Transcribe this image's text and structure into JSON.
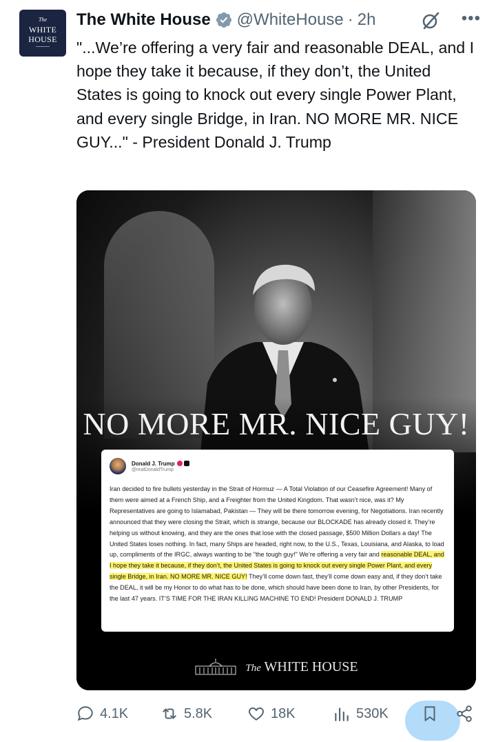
{
  "account": {
    "avatar_line1": "The",
    "avatar_line2": "WHITE",
    "avatar_line3": "HOUSE",
    "name": "The White House",
    "handle": "@WhiteHouse",
    "separator": "·",
    "time": "2h",
    "verified_icon": "verified-badge-icon",
    "more_label": "•••"
  },
  "tweet": {
    "text": "\"...We’re offering a very fair and reasonable DEAL, and I hope they take it because, if they don’t, the United States is going to knock out every single Power Plant, and every single Bridge, in Iran. NO MORE MR. NICE GUY...\" - President Donald J. Trump"
  },
  "media": {
    "headline": "NO MORE MR. NICE GUY!",
    "card": {
      "name": "Donald J. Trump",
      "handle": "@realDonaldTrump",
      "body_before": "Iran decided to fire bullets yesterday in the Strait of Hormuz — A Total Violation of our Ceasefire Agreement! Many of them were aimed at a French Ship, and a Freighter from the United Kingdom. That wasn’t nice, was it? My Representatives are going to Islamabad, Pakistan — They will be there tomorrow evening, for Negotiations. Iran recently announced that they were closing the Strait, which is strange, because our BLOCKADE has already closed it. They’re helping us without knowing, and they are the ones that lose with the closed passage, $500 Million Dollars a day! The United States loses nothing. In fact, many Ships are headed, right now, to the U.S., Texas, Louisiana, and Alaska, to load up, compliments of the IRGC, always wanting to be \"the tough guy!\" We’re offering a very fair and ",
      "body_highlight": "reasonable DEAL, and I hope they take it because, if they don’t, the United States is going to knock out every single Power Plant, and every single Bridge, in Iran. NO MORE MR. NICE GUY!",
      "body_after": " They’ll come down fast, they’ll come down easy and, if they don’t take the DEAL, it will be my Honor to do what has to be done, which should have been done to Iran, by other Presidents, for the last 47 years. IT’S TIME FOR THE IRAN KILLING MACHINE TO END! President DONALD J. TRUMP",
      "highlight_color": "#fff46a"
    },
    "logo_the": "The",
    "logo_text": "WHITE HOUSE"
  },
  "actions": {
    "replies": "4.1K",
    "reposts": "5.8K",
    "likes": "18K",
    "views": "530K"
  },
  "colors": {
    "text": "#0f1419",
    "muted": "#536471",
    "verified": "#829aab",
    "accent": "#1d9bf0"
  }
}
